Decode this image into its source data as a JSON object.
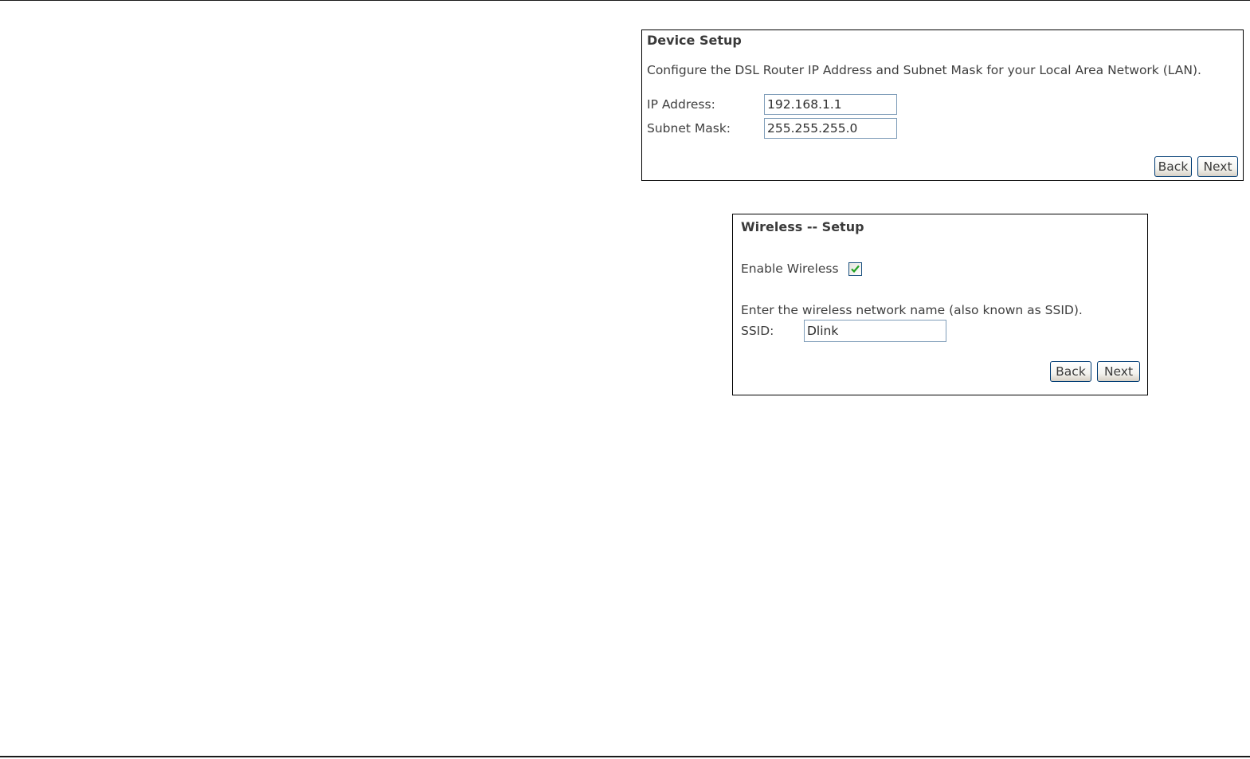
{
  "device_setup": {
    "title": "Device Setup",
    "description": "Configure the DSL Router IP Address and Subnet Mask for your Local Area Network (LAN).",
    "ip_address_label": "IP Address:",
    "ip_address_value": "192.168.1.1",
    "subnet_mask_label": "Subnet Mask:",
    "subnet_mask_value": "255.255.255.0",
    "back_label": "Back",
    "next_label": "Next"
  },
  "wireless_setup": {
    "title": "Wireless -- Setup",
    "enable_wireless_label": "Enable Wireless",
    "enable_wireless_checked": true,
    "ssid_prompt": "Enter the wireless network name (also known as SSID).",
    "ssid_label": "SSID:",
    "ssid_value": "Dlink",
    "back_label": "Back",
    "next_label": "Next"
  },
  "colors": {
    "checkmark": "#21a121",
    "input_border": "#7f9db9",
    "button_border": "#003c74"
  }
}
